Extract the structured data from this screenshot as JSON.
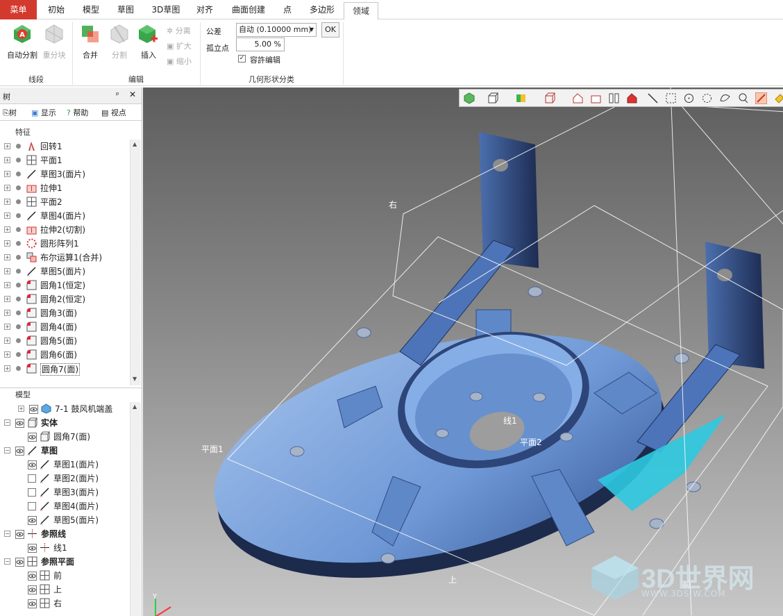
{
  "menu_tabs": [
    "菜单",
    "初始",
    "模型",
    "草图",
    "3D草图",
    "对齐",
    "曲面创建",
    "点",
    "多边形",
    "领域"
  ],
  "ribbon": {
    "segment": {
      "auto_split": "自动分割",
      "re_block": "重分块",
      "label": "线段"
    },
    "edit": {
      "merge": "合并",
      "split": "分割",
      "insert": "插入",
      "separate": "分离",
      "expand": "扩大",
      "shrink": "缩小",
      "label": "编辑"
    },
    "classify": {
      "tolerance_label": "公差",
      "tolerance_value": "自动 (0.10000 mm)",
      "ok": "OK",
      "isolated_label": "孤立点",
      "isolated_value": "5.00 %",
      "allow_edit": "容許编辑",
      "label": "几何形状分类"
    }
  },
  "tree_panel": {
    "title": "树",
    "tabs": [
      "树",
      "显示",
      "帮助",
      "视点"
    ],
    "features_label": "特征",
    "features": [
      "回转1",
      "平面1",
      "草图3(面片)",
      "拉伸1",
      "平面2",
      "草图4(面片)",
      "拉伸2(切割)",
      "圆形阵列1",
      "布尔运算1(合并)",
      "草图5(面片)",
      "圆角1(恒定)",
      "圆角2(恒定)",
      "圆角3(面)",
      "圆角4(面)",
      "圆角5(面)",
      "圆角6(面)",
      "圆角7(面)"
    ],
    "model_label": "模型",
    "model_tree": [
      {
        "label": "7-1 鼓风机端盖",
        "level": 1,
        "bold": false
      },
      {
        "label": "实体",
        "level": 0,
        "bold": true
      },
      {
        "label": "圆角7(面)",
        "level": 1,
        "bold": false
      },
      {
        "label": "草图",
        "level": 0,
        "bold": true
      },
      {
        "label": "草图1(面片)",
        "level": 1,
        "bold": false
      },
      {
        "label": "草图2(面片)",
        "level": 1,
        "bold": false
      },
      {
        "label": "草图3(面片)",
        "level": 1,
        "bold": false
      },
      {
        "label": "草图4(面片)",
        "level": 1,
        "bold": false
      },
      {
        "label": "草图5(面片)",
        "level": 1,
        "bold": false
      },
      {
        "label": "参照线",
        "level": 0,
        "bold": true
      },
      {
        "label": "线1",
        "level": 1,
        "bold": false
      },
      {
        "label": "参照平面",
        "level": 0,
        "bold": true
      },
      {
        "label": "前",
        "level": 1,
        "bold": false
      },
      {
        "label": "上",
        "level": 1,
        "bold": false
      },
      {
        "label": "右",
        "level": 1,
        "bold": false
      }
    ]
  },
  "viewport": {
    "labels": {
      "right": "右",
      "plane1": "平面1",
      "plane2": "平面2",
      "line1": "线1",
      "top": "上",
      "front": "前"
    },
    "axis": {
      "y": "Y"
    },
    "watermark": {
      "brand": "3D世界网",
      "url": "WWW.3DSJW.COM"
    }
  }
}
